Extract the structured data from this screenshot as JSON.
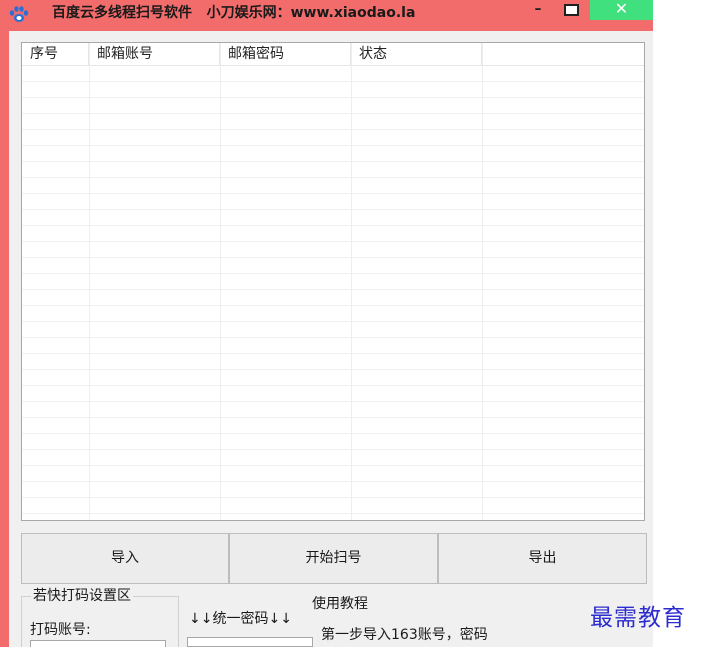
{
  "window": {
    "title": "百度云多线程扫号软件   小刀娱乐网：www.xiaodao.la",
    "icon": "paw-icon",
    "controls": {
      "minimize": "–",
      "close": "✕"
    }
  },
  "listview": {
    "columns": [
      "序号",
      "邮箱账号",
      "邮箱密码",
      "状态"
    ],
    "rows": []
  },
  "buttons": {
    "import": "导入",
    "start_scan": "开始扫号",
    "export": "导出"
  },
  "captcha_group": {
    "title": "若快打码设置区",
    "account_label": "打码账号:"
  },
  "password_section": {
    "label": "↓↓统一密码↓↓"
  },
  "tutorial": {
    "title": "使用教程",
    "step1": "第一步导入163账号，密码"
  },
  "watermark": "最需教育",
  "colors": {
    "frame": "#f36c6c",
    "close_button": "#3fe07d",
    "watermark": "#2c2cd0"
  }
}
